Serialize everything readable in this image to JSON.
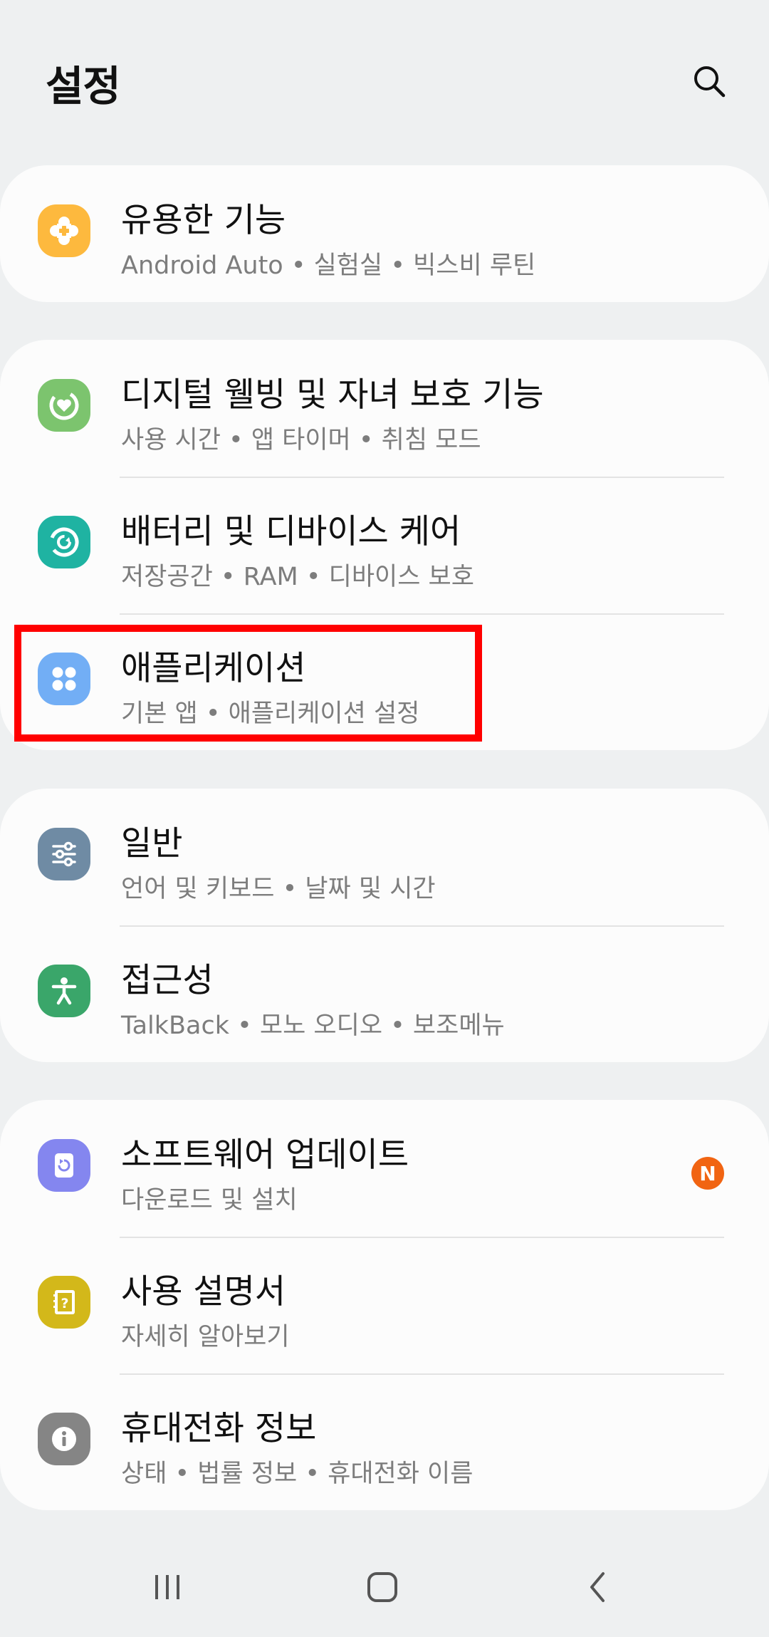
{
  "header": {
    "title": "설정",
    "search_icon": "search-icon"
  },
  "groups": [
    {
      "items": [
        {
          "title": "유용한 기능",
          "subtitle": "Android Auto • 실험실 • 빅스비 루틴",
          "icon": "puzzle-icon",
          "icon_color": "#fdb93e"
        }
      ]
    },
    {
      "items": [
        {
          "title": "디지털 웰빙 및 자녀 보호 기능",
          "subtitle": "사용 시간 • 앱 타이머 • 취침 모드",
          "icon": "wellbeing-heart-icon",
          "icon_color": "#7cc46e"
        },
        {
          "title": "배터리 및 디바이스 케어",
          "subtitle": "저장공간 • RAM • 디바이스 보호",
          "icon": "device-care-icon",
          "icon_color": "#1fb3a2"
        },
        {
          "title": "애플리케이션",
          "subtitle": "기본 앱 • 애플리케이션 설정",
          "icon": "apps-grid-icon",
          "icon_color": "#72aef5"
        }
      ]
    },
    {
      "items": [
        {
          "title": "일반",
          "subtitle": "언어 및 키보드 • 날짜 및 시간",
          "icon": "sliders-icon",
          "icon_color": "#6f8ba4"
        },
        {
          "title": "접근성",
          "subtitle": "TalkBack • 모노 오디오 • 보조메뉴",
          "icon": "accessibility-person-icon",
          "icon_color": "#3aa66a"
        }
      ]
    },
    {
      "items": [
        {
          "title": "소프트웨어 업데이트",
          "subtitle": "다운로드 및 설치",
          "icon": "software-update-icon",
          "icon_color": "#8486ef",
          "badge": "N",
          "badge_color": "#f16412"
        },
        {
          "title": "사용 설명서",
          "subtitle": "자세히 알아보기",
          "icon": "user-manual-icon",
          "icon_color": "#d3b81a"
        },
        {
          "title": "휴대전화 정보",
          "subtitle": "상태 • 법률 정보 • 휴대전화 이름",
          "icon": "info-icon",
          "icon_color": "#858585"
        }
      ]
    }
  ],
  "highlight_color": "#ff0000",
  "navbar": {
    "recents_icon": "recents-icon",
    "home_icon": "home-icon",
    "back_icon": "back-icon"
  }
}
